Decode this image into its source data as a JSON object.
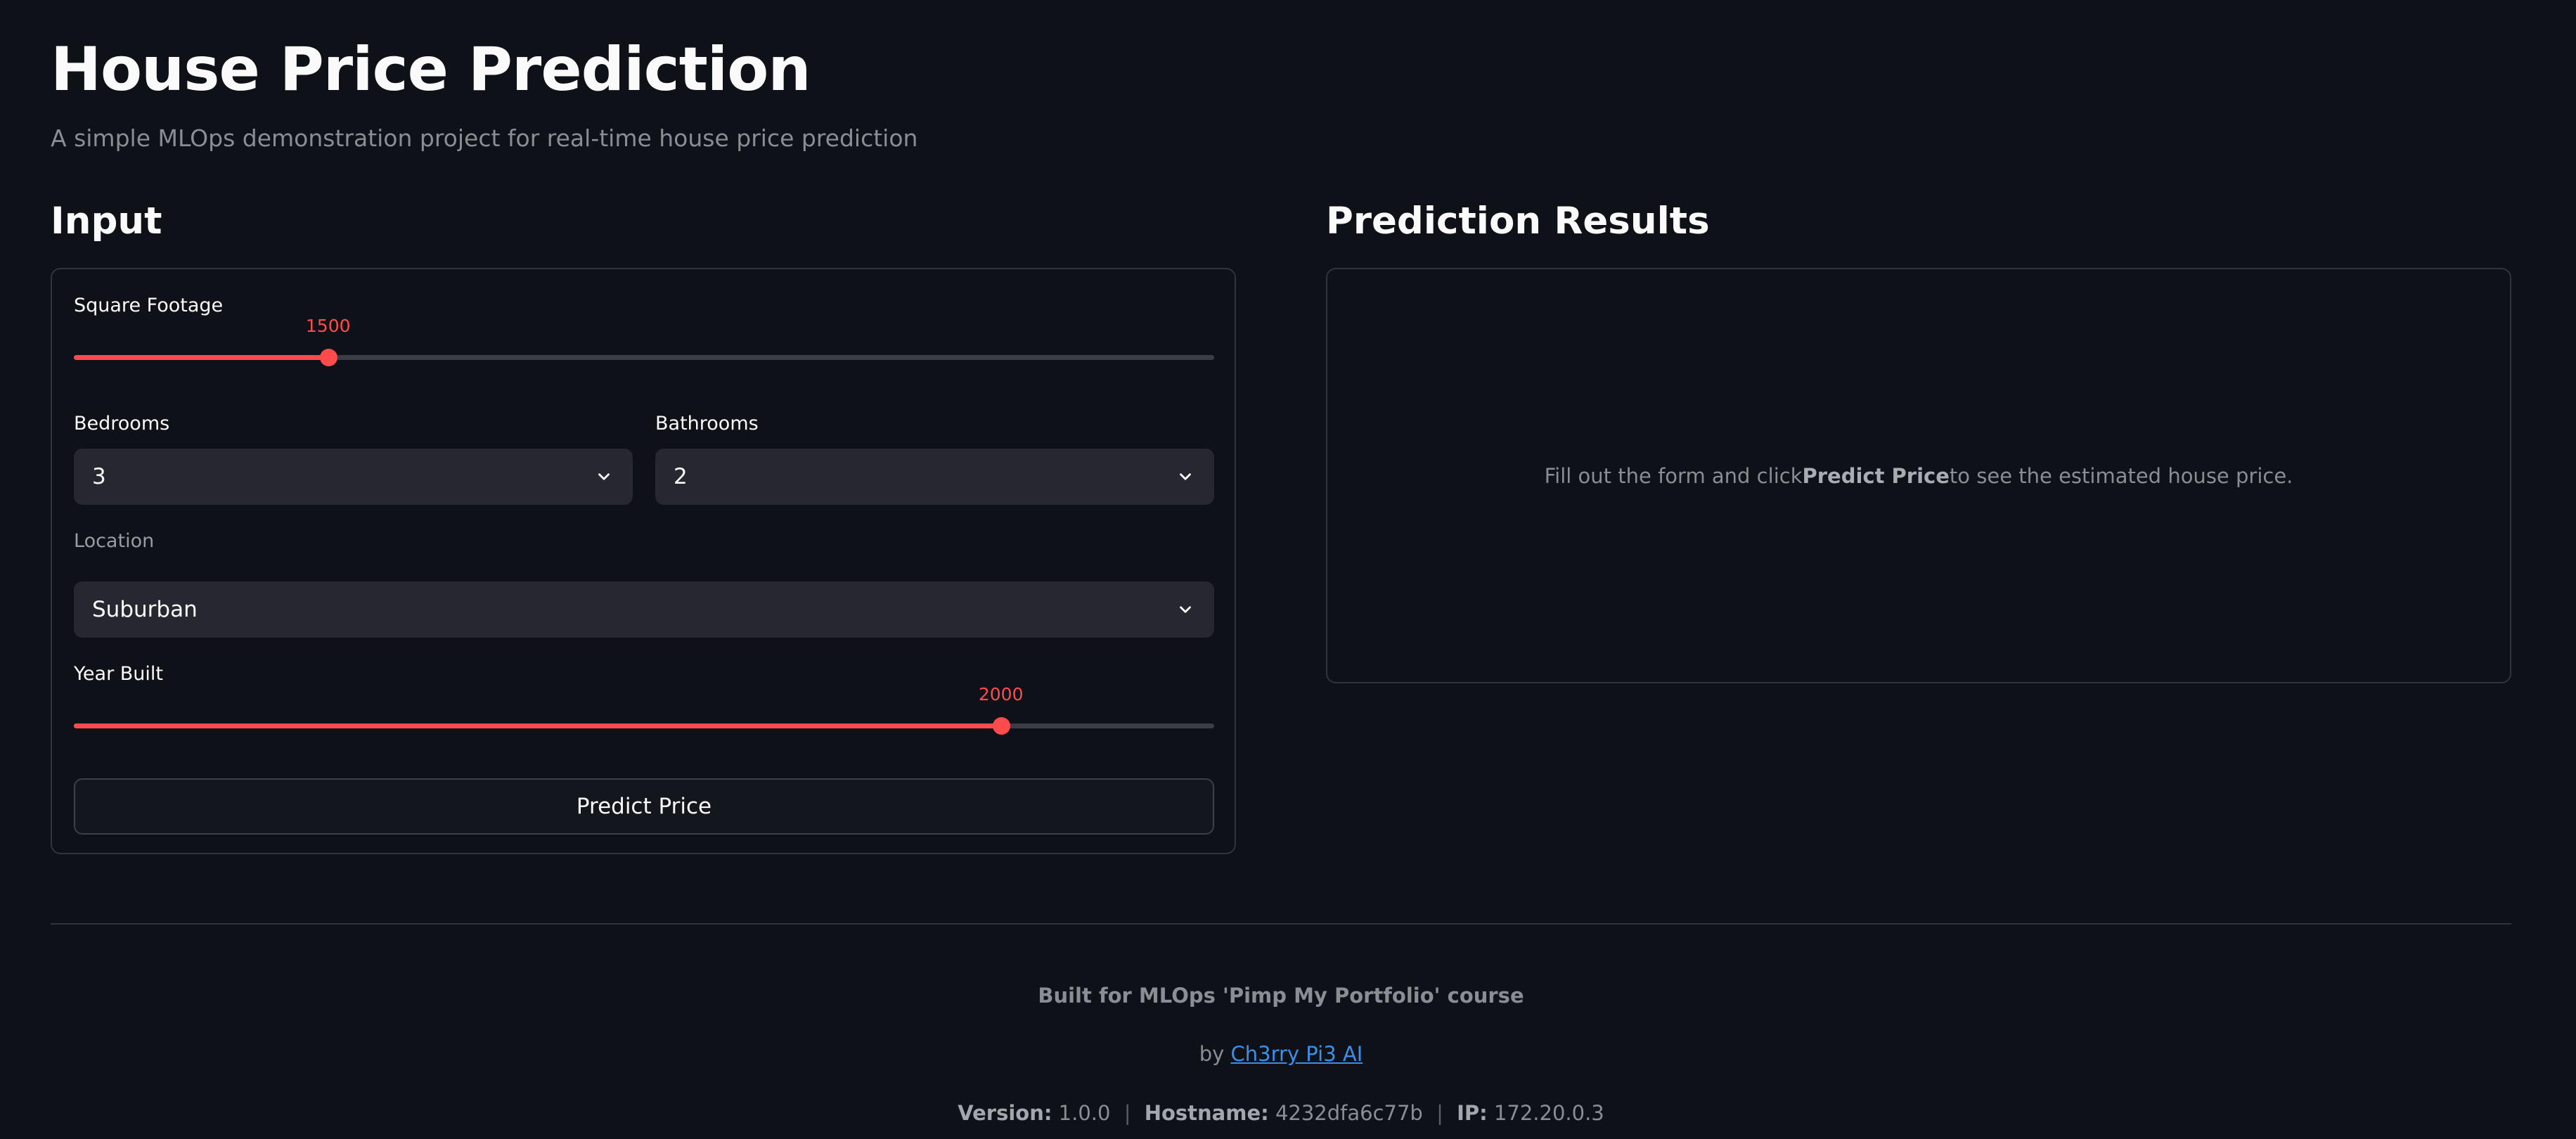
{
  "header": {
    "title": "House Price Prediction",
    "subtitle": "A simple MLOps demonstration project for real-time house price prediction"
  },
  "input_section": {
    "heading": "Input",
    "square_footage": {
      "label": "Square Footage",
      "value": "1500",
      "fraction": 0.223
    },
    "bedrooms": {
      "label": "Bedrooms",
      "value": "3"
    },
    "bathrooms": {
      "label": "Bathrooms",
      "value": "2"
    },
    "location": {
      "label": "Location",
      "value": "Suburban"
    },
    "year_built": {
      "label": "Year Built",
      "value": "2000",
      "fraction": 0.813
    },
    "predict_button_label": "Predict Price"
  },
  "results_section": {
    "heading": "Prediction Results",
    "placeholder_before": "Fill out the form and click",
    "placeholder_bold": "Predict Price",
    "placeholder_after": "to see the estimated house price."
  },
  "footer": {
    "built_for": "Built for MLOps 'Pimp My Portfolio' course",
    "by_prefix": "by",
    "author_link": "Ch3rry Pi3 AI",
    "version_key": "Version:",
    "version_value": "1.0.0",
    "hostname_key": "Hostname:",
    "hostname_value": "4232dfa6c77b",
    "ip_key": "IP:",
    "ip_value": "172.20.0.3",
    "separator": "|"
  },
  "colors": {
    "background": "#0e1117",
    "accent": "#ff4b4b",
    "link": "#3d8fe6"
  },
  "icons": {
    "dropdown": "chevron-down-icon"
  }
}
